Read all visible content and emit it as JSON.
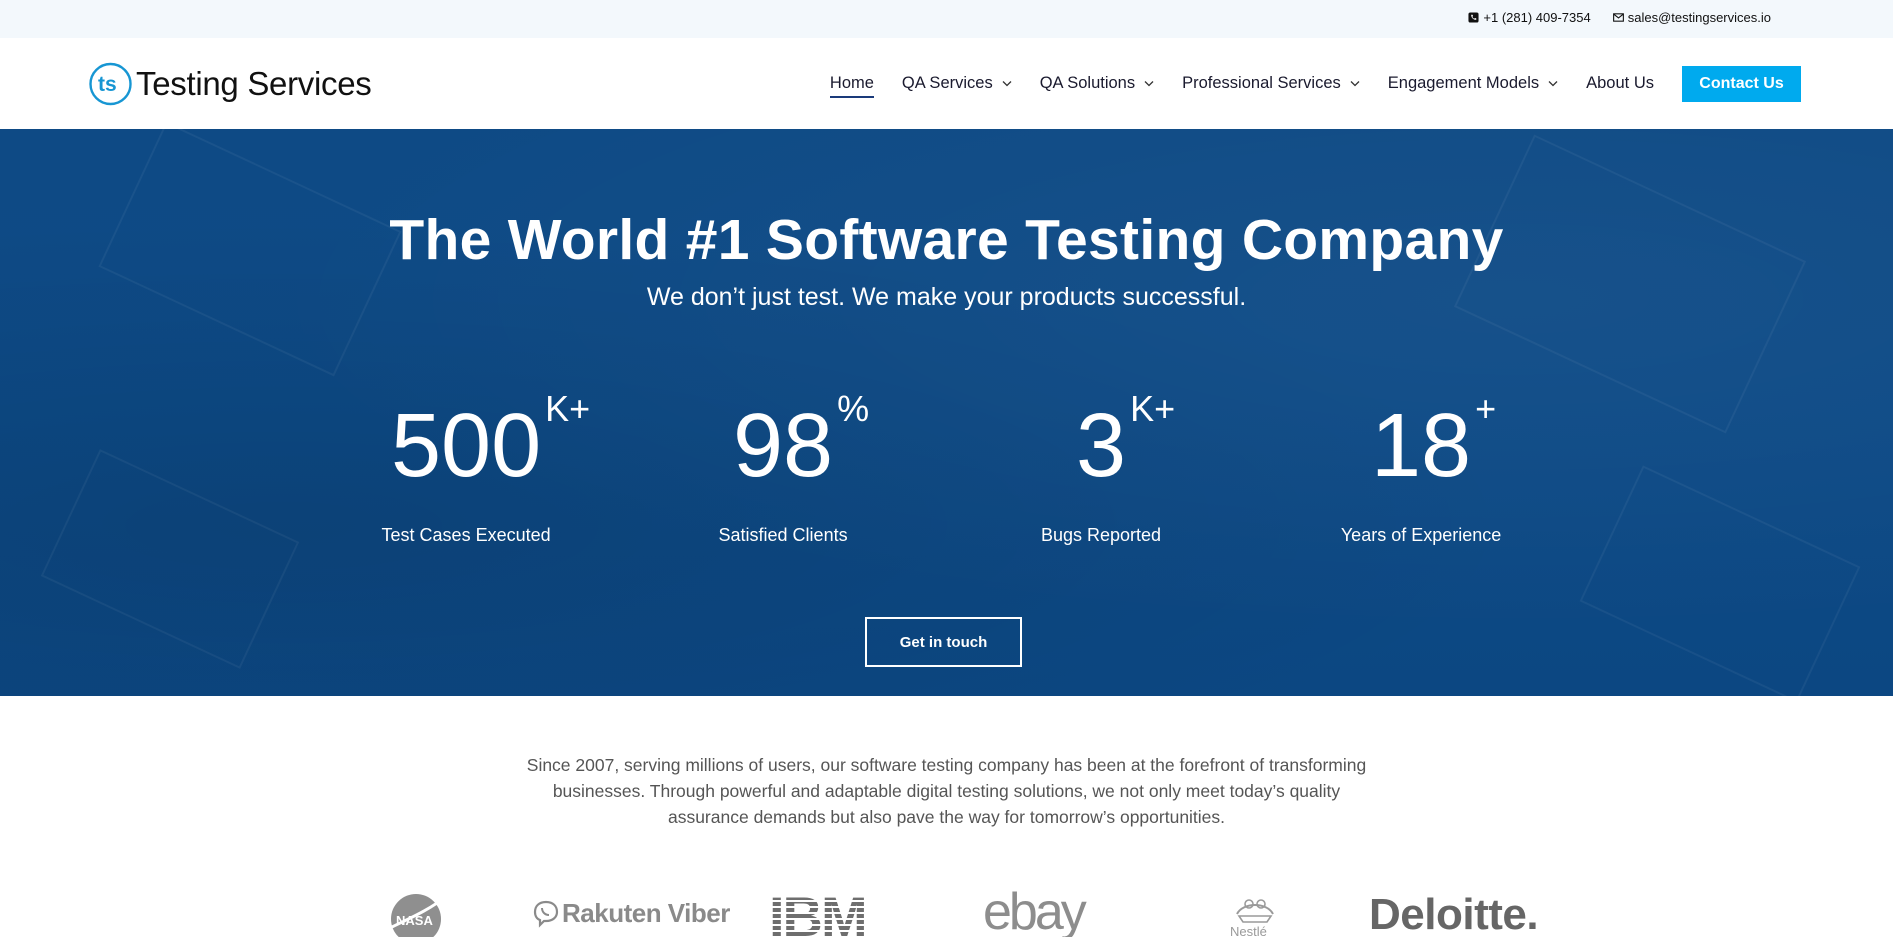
{
  "topbar": {
    "phone": "+1 (281) 409-7354",
    "email": "sales@testingservices.io"
  },
  "header": {
    "logo_text": "Testing Services",
    "nav": [
      {
        "label": "Home"
      },
      {
        "label": "QA Services"
      },
      {
        "label": "QA Solutions"
      },
      {
        "label": "Professional Services"
      },
      {
        "label": "Engagement Models"
      },
      {
        "label": "About Us"
      }
    ],
    "contact_label": "Contact Us"
  },
  "hero": {
    "title": "The World #1 Software Testing Company",
    "subtitle": "We don’t just test. We make your products successful.",
    "stats": [
      {
        "value": "500",
        "suffix": "K+",
        "label": "Test Cases Executed"
      },
      {
        "value": "98",
        "suffix": "%",
        "label": "Satisfied Clients"
      },
      {
        "value": "3",
        "suffix": "K+",
        "label": "Bugs Reported"
      },
      {
        "value": "18",
        "suffix": "+",
        "label": "Years of Experience"
      }
    ],
    "cta_label": "Get in touch"
  },
  "intro": {
    "text": "Since 2007, serving millions of users, our software testing company has been at the forefront of transforming businesses. Through powerful and adaptable digital testing solutions, we not only meet today’s quality assurance demands but also pave the way for tomorrow’s opportunities."
  },
  "clients": {
    "logos": [
      "NASA",
      "Rakuten Viber",
      "IBM",
      "ebay",
      "Nestlé",
      "Deloitte."
    ]
  },
  "colors": {
    "accent": "#00aaee",
    "hero_bg": "#0d4a86",
    "nav_active": "#1a3a7a"
  }
}
